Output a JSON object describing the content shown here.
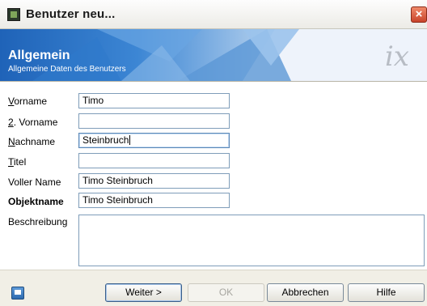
{
  "window": {
    "title": "Benutzer neu...",
    "close_label": "×"
  },
  "header": {
    "title": "Allgemein",
    "subtitle": "Allgemeine Daten des Benutzers",
    "logo": "ix"
  },
  "form": {
    "vorname": {
      "label": "Vorname",
      "accesskey": "V",
      "value": "Timo"
    },
    "vorname2": {
      "label": "2. Vorname",
      "accesskey": "2",
      "value": ""
    },
    "nachname": {
      "label": "Nachname",
      "accesskey": "N",
      "value": "Steinbruch"
    },
    "titel": {
      "label": "Titel",
      "accesskey": "T",
      "value": ""
    },
    "voller_name": {
      "label": "Voller Name",
      "value": "Timo Steinbruch"
    },
    "objektname": {
      "label": "Objektname",
      "value": "Timo Steinbruch"
    },
    "beschreibung": {
      "label": "Beschreibung",
      "value": ""
    }
  },
  "footer": {
    "weiter": "Weiter >",
    "ok": "OK",
    "abbrechen": "Abbrechen",
    "hilfe": "Hilfe"
  }
}
